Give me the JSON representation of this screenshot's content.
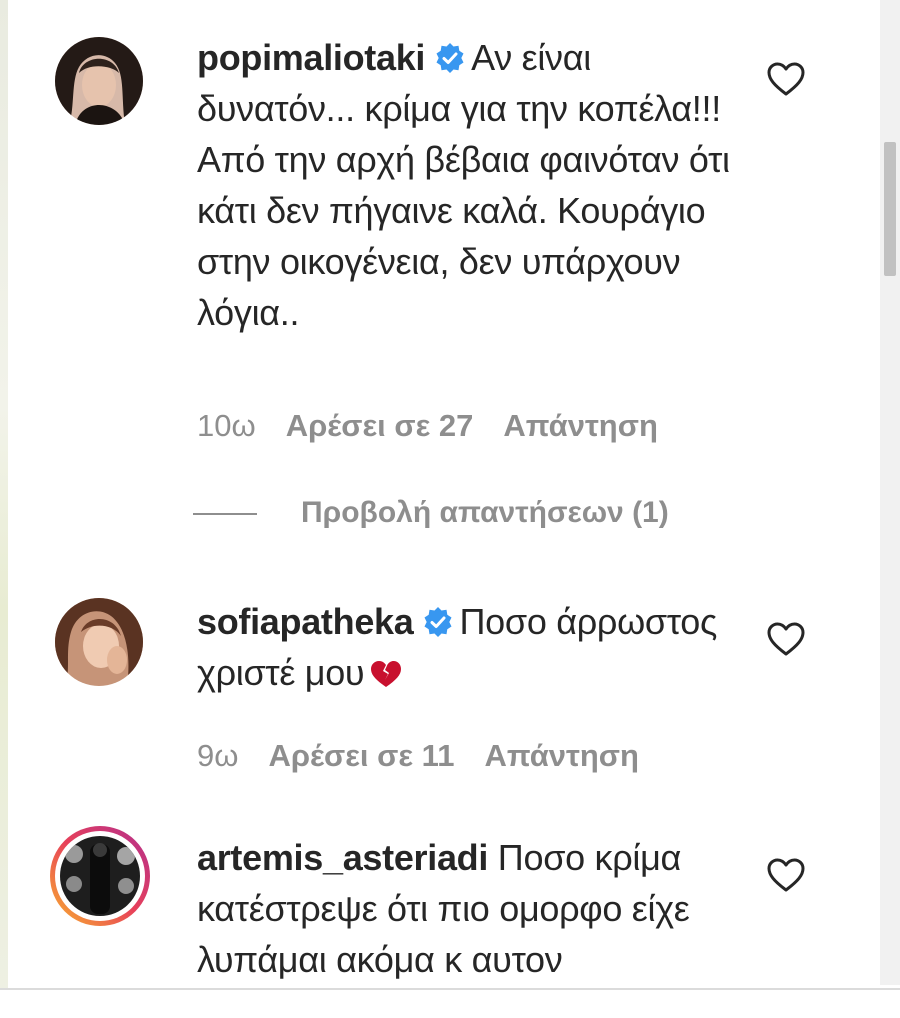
{
  "comments": [
    {
      "username": "popimaliotaki",
      "verified": true,
      "text": "Αν είναι δυνατόν... κρίμα για την κοπέλα!!! Από την αρχή βέβαια φαινόταν ότι κάτι δεν πήγαινε καλά. Κουράγιο στην οικογένεια, δεν υπάρχουν λόγια..",
      "time": "10ω",
      "likes": "Αρέσει σε 27",
      "reply": "Απάντηση",
      "view_replies": "Προβολή απαντήσεων (1)"
    },
    {
      "username": "sofiapatheka",
      "verified": true,
      "text": "Ποσο άρρωστος χριστέ μου",
      "emoji": "broken-heart",
      "time": "9ω",
      "likes": "Αρέσει σε 11",
      "reply": "Απάντηση"
    },
    {
      "username": "artemis_asteriadi",
      "verified": false,
      "text": "Ποσο κρίμα κατέστρεψε ότι πιο ομορφο είχε λυπάμαι ακόμα κ αυτον"
    }
  ],
  "icons": {
    "like": "heart-outline-icon",
    "verified": "verified-badge-icon"
  },
  "colors": {
    "verified_blue": "#3897f0",
    "meta_gray": "#8e8e8e",
    "text": "#262626",
    "broken_heart": "#c8102e"
  }
}
